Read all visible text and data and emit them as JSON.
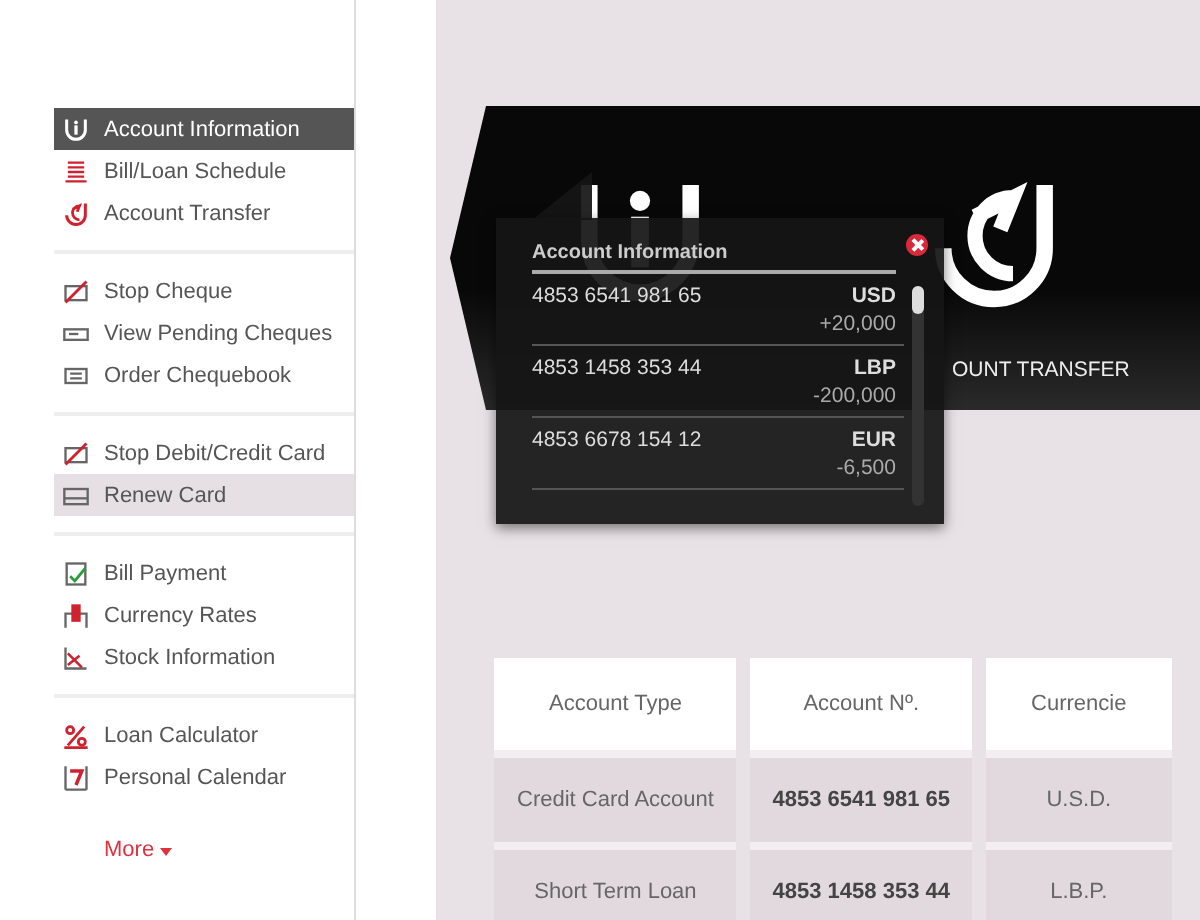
{
  "sidebar": {
    "groups": [
      {
        "items": [
          {
            "label": "Account Information",
            "selected": true,
            "highlighted": false
          },
          {
            "label": "Bill/Loan Schedule",
            "selected": false,
            "highlighted": false
          },
          {
            "label": "Account Transfer",
            "selected": false,
            "highlighted": false
          }
        ]
      },
      {
        "items": [
          {
            "label": "Stop Cheque",
            "selected": false,
            "highlighted": false
          },
          {
            "label": "View Pending Cheques",
            "selected": false,
            "highlighted": false
          },
          {
            "label": "Order Chequebook",
            "selected": false,
            "highlighted": false
          }
        ]
      },
      {
        "items": [
          {
            "label": "Stop Debit/Credit Card",
            "selected": false,
            "highlighted": false
          },
          {
            "label": "Renew Card",
            "selected": false,
            "highlighted": true
          }
        ]
      },
      {
        "items": [
          {
            "label": "Bill Payment",
            "selected": false,
            "highlighted": false
          },
          {
            "label": "Currency Rates",
            "selected": false,
            "highlighted": false
          },
          {
            "label": "Stock Information",
            "selected": false,
            "highlighted": false
          }
        ]
      },
      {
        "items": [
          {
            "label": "Loan Calculator",
            "selected": false,
            "highlighted": false
          },
          {
            "label": "Personal Calendar",
            "selected": false,
            "highlighted": false
          }
        ]
      }
    ],
    "more": "More"
  },
  "banner": {
    "transfer_label": "OUNT TRANSFER"
  },
  "popup": {
    "title": "Account Information",
    "accounts": [
      {
        "number": "4853 6541 981 65",
        "currency": "USD",
        "amount": "+20,000"
      },
      {
        "number": "4853 1458 353 44",
        "currency": "LBP",
        "amount": "-200,000"
      },
      {
        "number": "4853 6678 154 12",
        "currency": "EUR",
        "amount": "-6,500"
      }
    ]
  },
  "table": {
    "columns": [
      "Account Type",
      "Account Nº.",
      "Currencie"
    ],
    "rows": [
      [
        "Credit Card Account",
        "4853 6541 981 65",
        "U.S.D."
      ],
      [
        "Short Term Loan",
        "4853 1458 353 44",
        "L.B.P."
      ]
    ]
  }
}
